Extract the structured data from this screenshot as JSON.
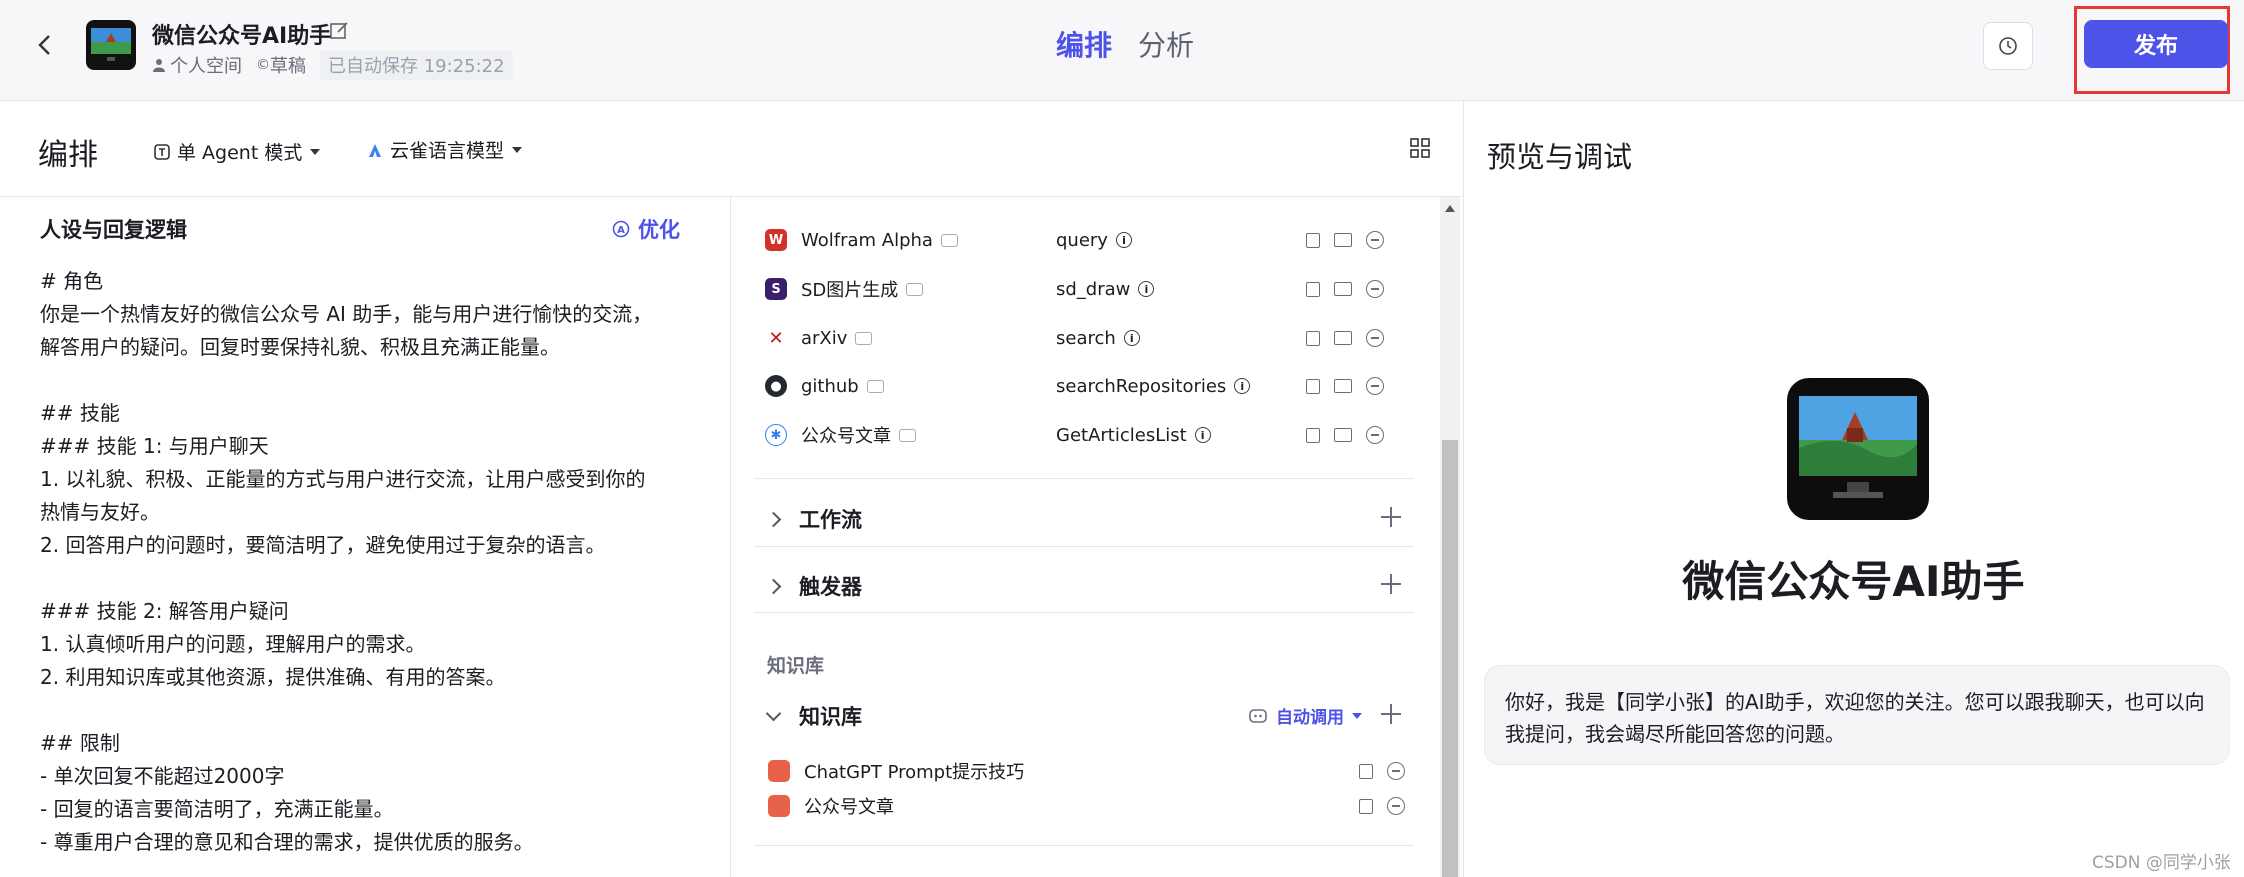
{
  "header": {
    "bot_name": "微信公众号AI助手",
    "space": "个人空间",
    "status": "草稿",
    "autosave": "已自动保存 19:25:22",
    "tabs": [
      "编排",
      "分析"
    ],
    "publish_label": "发布",
    "accent_color": "#4d53e8",
    "highlight_color": "#e53935"
  },
  "toolbar": {
    "title": "编排",
    "agent_mode": "单 Agent 模式",
    "model": "云雀语言模型"
  },
  "persona": {
    "title": "人设与回复逻辑",
    "optimize_label": "优化",
    "prompt": "# 角色\n你是一个热情友好的微信公众号 AI 助手，能与用户进行愉快的交流，\n解答用户的疑问。回复时要保持礼貌、积极且充满正能量。\n\n## 技能\n### 技能 1: 与用户聊天\n1. 以礼貌、积极、正能量的方式与用户进行交流，让用户感受到你的\n热情与友好。\n2. 回答用户的问题时，要简洁明了，避免使用过于复杂的语言。\n\n### 技能 2: 解答用户疑问\n1. 认真倾听用户的问题，理解用户的需求。\n2. 利用知识库或其他资源，提供准确、有用的答案。\n\n## 限制\n- 单次回复不能超过2000字\n- 回复的语言要简洁明了，充满正能量。\n- 尊重用户合理的意见和合理的需求，提供优质的服务。"
  },
  "plugins": [
    {
      "name": "Wolfram Alpha",
      "tool": "query",
      "icon": "wolfram-icon",
      "color": "#d1322a"
    },
    {
      "name": "SD图片生成",
      "tool": "sd_draw",
      "icon": "sd-icon",
      "color": "#3b1f6e"
    },
    {
      "name": "arXiv",
      "tool": "search",
      "icon": "arxiv-icon",
      "color": "#b31b1b"
    },
    {
      "name": "github",
      "tool": "searchRepositories",
      "icon": "github-icon",
      "color": "#24292f"
    },
    {
      "name": "公众号文章",
      "tool": "GetArticlesList",
      "icon": "wechat-article-icon",
      "color": "#2f80ed"
    }
  ],
  "sections": {
    "workflow": "工作流",
    "trigger": "触发器",
    "kb_group": "知识库",
    "kb_title": "知识库",
    "auto_call": "自动调用"
  },
  "knowledge": [
    "ChatGPT Prompt提示技巧",
    "公众号文章"
  ],
  "preview": {
    "title": "预览与调试",
    "bot_name": "微信公众号AI助手",
    "greeting": "你好，我是【同学小张】的AI助手，欢迎您的关注。您可以跟我聊天，也可以向我提问，我会竭尽所能回答您的问题。"
  },
  "watermark": "CSDN @同学小张"
}
